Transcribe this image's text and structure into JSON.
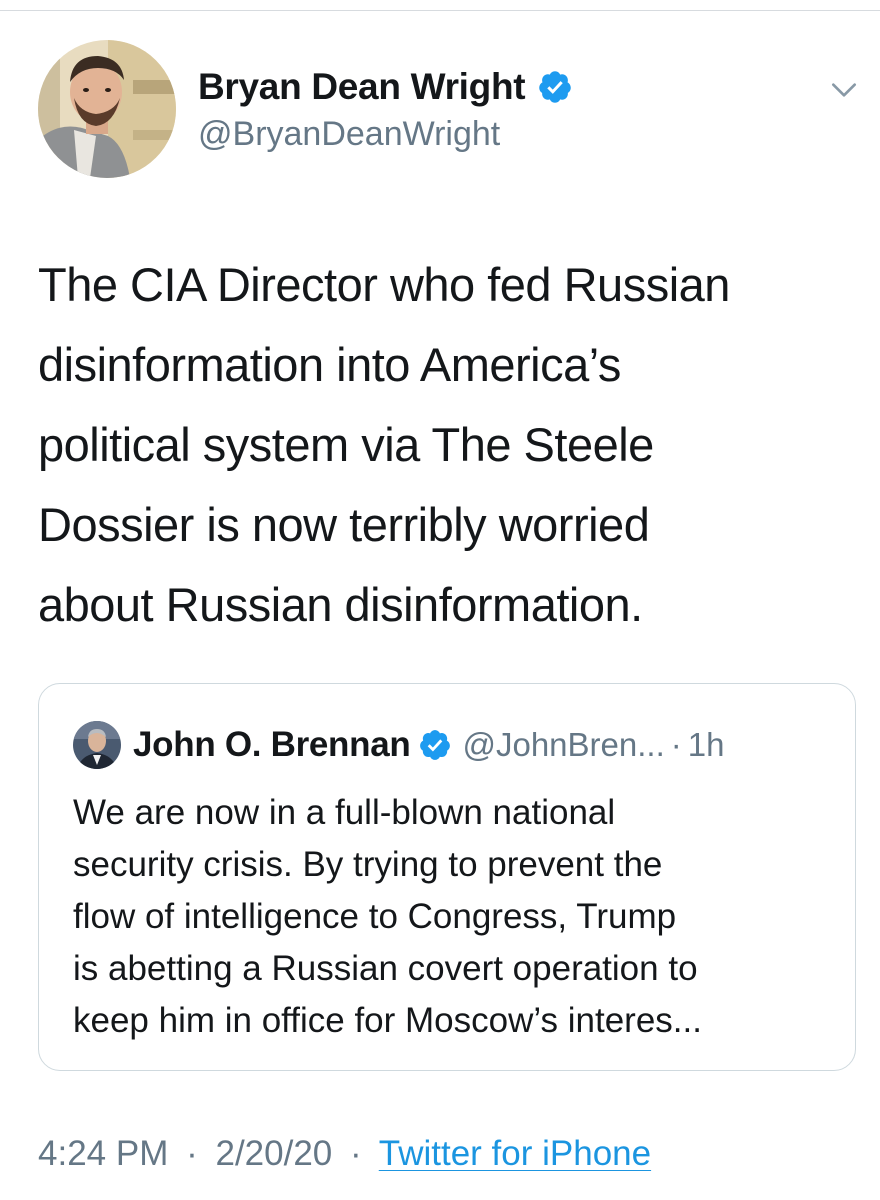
{
  "tweet": {
    "author": {
      "name": "Bryan Dean Wright",
      "handle": "@BryanDeanWright",
      "verified": true
    },
    "text": "The CIA Director who fed Russian\ndisinformation into America’s\npolitical system via The Steele\nDossier is now terribly worried\nabout Russian disinformation.",
    "timestamp": "4:24 PM",
    "date": "2/20/20",
    "meta_separator": "·",
    "source": "Twitter for iPhone"
  },
  "quoted_tweet": {
    "author": {
      "name": "John O. Brennan",
      "handle": "@JohnBren...",
      "verified": true
    },
    "separator": "·",
    "time": "1h",
    "text": "We are now in a full-blown national\nsecurity crisis. By trying to prevent the\nflow of intelligence to Congress, Trump\nis abetting a Russian covert operation to\nkeep him in office for Moscow’s interes..."
  },
  "icons": {
    "verified": "verified-badge-icon",
    "caret": "chevron-down-icon"
  },
  "colors": {
    "verified_blue": "#1d9bf0",
    "link_blue": "#1b95e0",
    "secondary_text": "#657786",
    "primary_text": "#14171a",
    "border": "#cfd9de"
  }
}
